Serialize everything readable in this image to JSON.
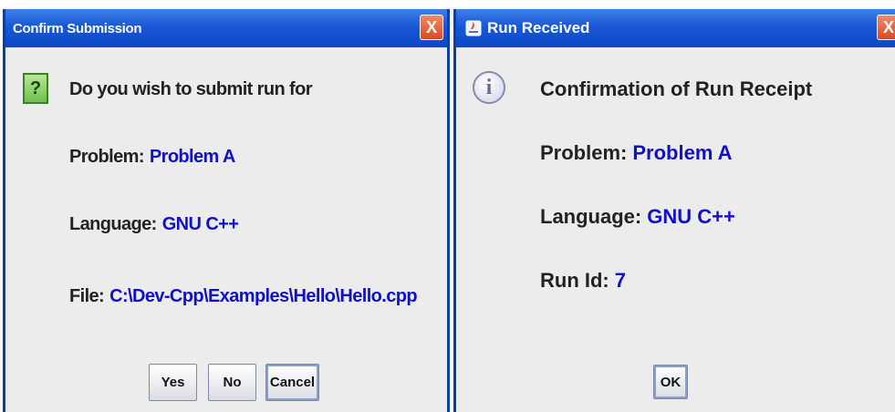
{
  "confirm_dialog": {
    "title": "Confirm Submission",
    "close_glyph": "X",
    "icon": "question-icon",
    "question_glyph": "?",
    "message": "Do you wish to submit run for",
    "problem_label": "Problem:",
    "problem_value": "Problem A",
    "language_label": "Language:",
    "language_value": "GNU C++",
    "file_label": "File:",
    "file_value": "C:\\Dev-Cpp\\Examples\\Hello\\Hello.cpp",
    "buttons": {
      "yes": "Yes",
      "no": "No",
      "cancel": "Cancel"
    }
  },
  "run_dialog": {
    "title": "Run Received",
    "close_glyph": "X",
    "icon": "info-icon",
    "info_glyph": "i",
    "heading": "Confirmation of Run Receipt",
    "problem_label": "Problem:",
    "problem_value": "Problem A",
    "language_label": "Language:",
    "language_value": "GNU C++",
    "run_id_label": "Run Id:",
    "run_id_value": "7",
    "ok": "OK"
  },
  "colors": {
    "titlebar": "#1858d6",
    "value_text": "#1010c8",
    "dialog_bg": "#ececec",
    "close_button": "#d84a22"
  }
}
